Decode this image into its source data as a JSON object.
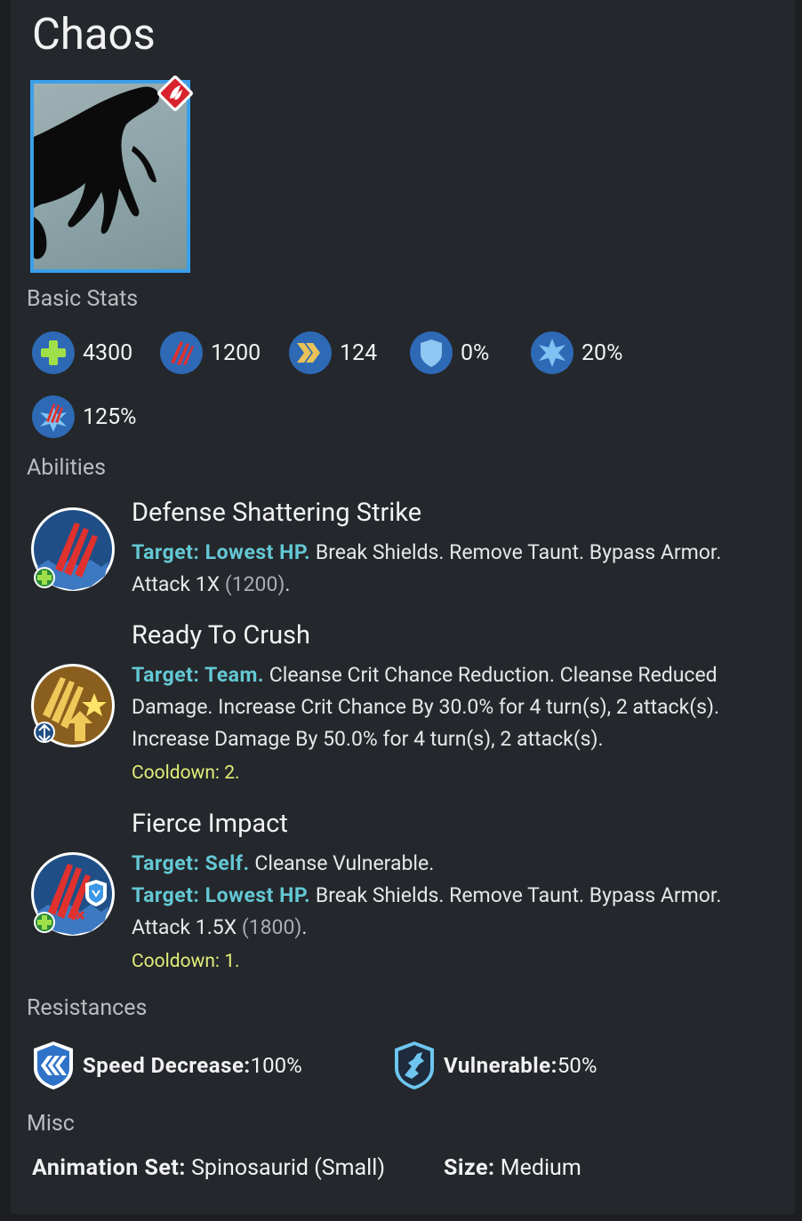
{
  "title": "Chaos",
  "sections": {
    "basic_stats": "Basic Stats",
    "abilities": "Abilities",
    "resistances": "Resistances",
    "misc": "Misc"
  },
  "stats": [
    {
      "icon": "health-icon",
      "value": "4300"
    },
    {
      "icon": "damage-icon",
      "value": "1200"
    },
    {
      "icon": "speed-icon",
      "value": "124"
    },
    {
      "icon": "armor-icon",
      "value": "0%"
    },
    {
      "icon": "crit-chance-icon",
      "value": "20%"
    },
    {
      "icon": "crit-damage-icon",
      "value": "125%"
    }
  ],
  "abilities": [
    {
      "name": "Defense Shattering Strike",
      "lines": [
        {
          "target": "Target: Lowest HP.",
          "text": " Break Shields. Remove Taunt. Bypass Armor. Attack 1X ",
          "dim": "(1200)",
          "end": "."
        }
      ],
      "cooldown": ""
    },
    {
      "name": "Ready To Crush",
      "lines": [
        {
          "target": "Target: Team.",
          "text": " Cleanse Crit Chance Reduction. Cleanse Reduced Damage. Increase Crit Chance By 30.0% for 4 turn(s), 2 attack(s). Increase Damage By 50.0% for 4 turn(s), 2 attack(s).",
          "dim": "",
          "end": ""
        }
      ],
      "cooldown": "Cooldown: 2."
    },
    {
      "name": "Fierce Impact",
      "lines": [
        {
          "target": "Target: Self.",
          "text": " Cleanse Vulnerable.",
          "dim": "",
          "end": ""
        },
        {
          "target": "Target: Lowest HP.",
          "text": " Break Shields. Remove Taunt. Bypass Armor. Attack 1.5X ",
          "dim": "(1800)",
          "end": "."
        }
      ],
      "cooldown": "Cooldown: 1."
    }
  ],
  "resistances": [
    {
      "icon": "speed-decrease-shield-icon",
      "label": "Speed Decrease:",
      "value": " 100%"
    },
    {
      "icon": "vulnerable-shield-icon",
      "label": "Vulnerable:",
      "value": " 50%"
    }
  ],
  "misc": {
    "animation_label": "Animation Set:",
    "animation_value": " Spinosaurid (Small)",
    "size_label": "Size:",
    "size_value": " Medium"
  },
  "colors": {
    "background": "#24272b",
    "target_text": "#63c8d4",
    "cooldown_text": "#e2ee7a",
    "portrait_border": "#3aa0ea",
    "rarity_badge": "#d8232f"
  }
}
